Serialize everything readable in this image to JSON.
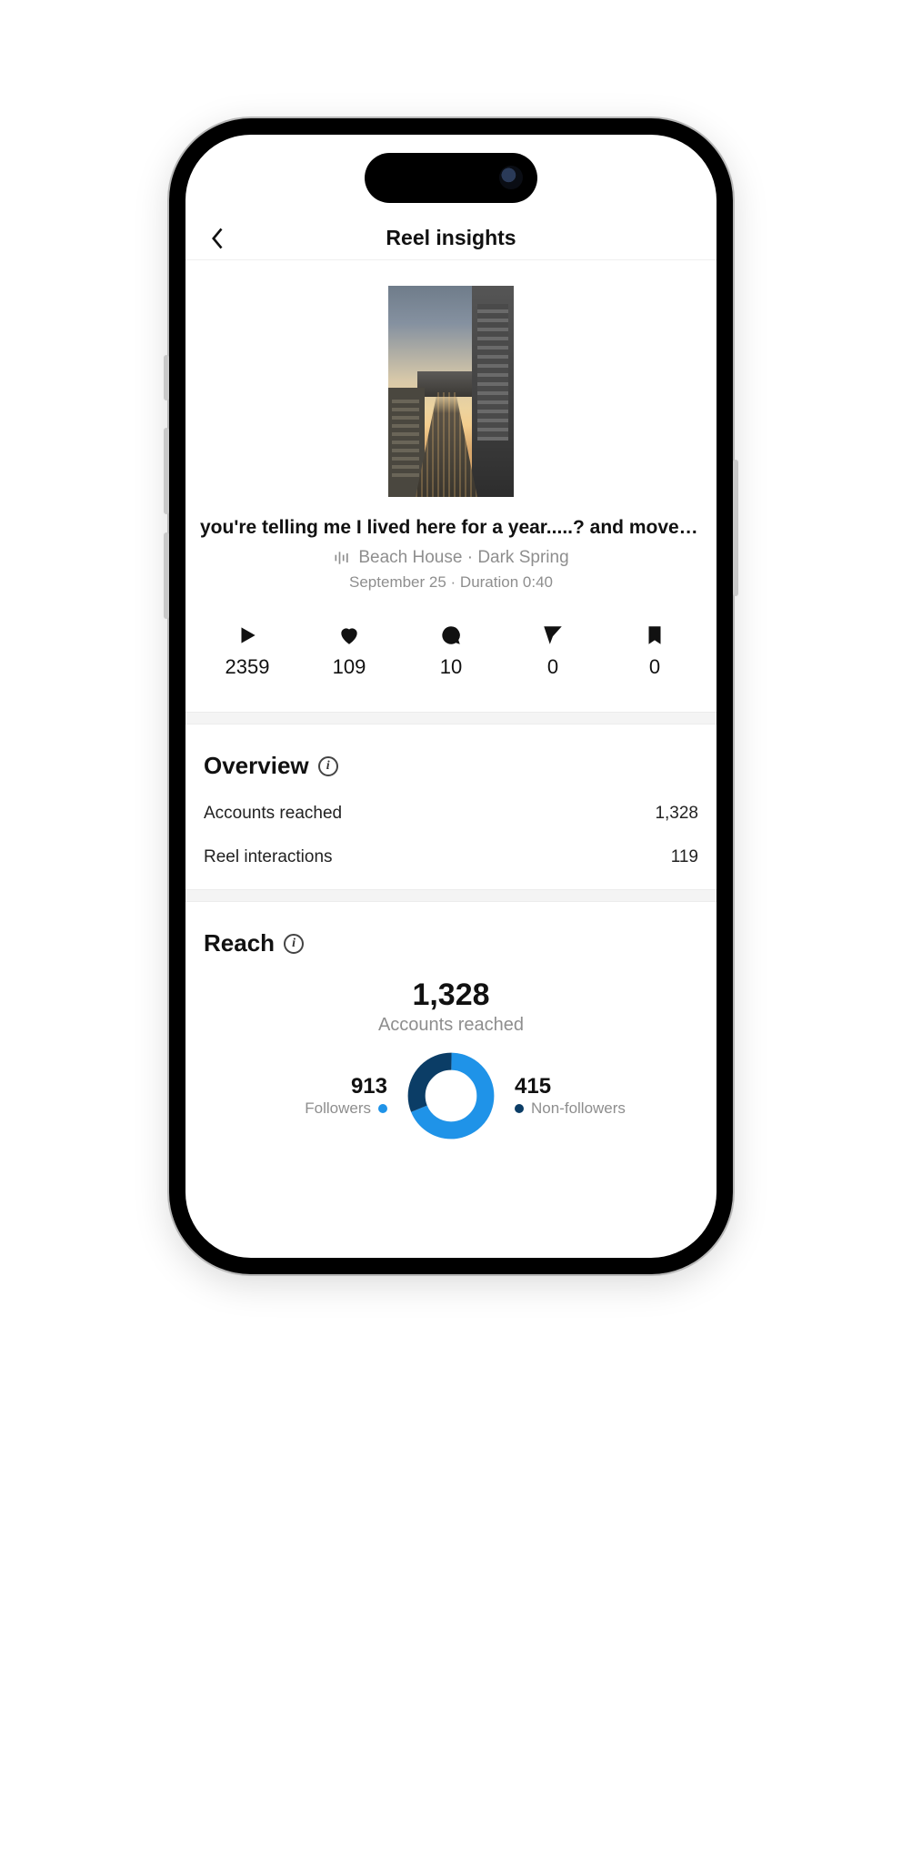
{
  "header": {
    "title": "Reel insights"
  },
  "reel": {
    "caption": "you're telling me I lived here for a year.....? and moved a...",
    "audio": "Beach House · Dark Spring",
    "meta": "September 25 · Duration 0:40"
  },
  "stats": {
    "plays": "2359",
    "likes": "109",
    "comments": "10",
    "shares": "0",
    "saves": "0"
  },
  "overview": {
    "title": "Overview",
    "accounts_reached_label": "Accounts reached",
    "accounts_reached_value": "1,328",
    "interactions_label": "Reel interactions",
    "interactions_value": "119"
  },
  "reach": {
    "title": "Reach",
    "total": "1,328",
    "subtitle": "Accounts reached",
    "followers_value": "913",
    "followers_label": "Followers",
    "nonfollowers_value": "415",
    "nonfollowers_label": "Non-followers"
  },
  "chart_data": {
    "type": "pie",
    "title": "Accounts reached",
    "series": [
      {
        "name": "Followers",
        "value": 913,
        "color": "#1f93e8"
      },
      {
        "name": "Non-followers",
        "value": 415,
        "color": "#0b3d66"
      }
    ],
    "total": 1328
  }
}
